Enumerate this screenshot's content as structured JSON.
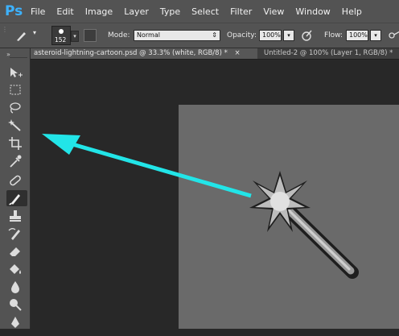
{
  "app": {
    "logo": "Ps"
  },
  "menu": [
    "File",
    "Edit",
    "Image",
    "Layer",
    "Type",
    "Select",
    "Filter",
    "View",
    "Window",
    "Help"
  ],
  "options": {
    "brush_size": "152",
    "mode_label": "Mode:",
    "mode_value": "Normal",
    "opacity_label": "Opacity:",
    "opacity_value": "100%",
    "flow_label": "Flow:",
    "flow_value": "100%"
  },
  "tabs": [
    {
      "label": "asteroid-lightning-cartoon.psd @ 33.3% (white, RGB/8) *",
      "close": "×",
      "active": true
    },
    {
      "label": "Untitled-2 @ 100% (Layer 1, RGB/8) *",
      "close": "×",
      "active": false
    }
  ],
  "annotation": {
    "arrow_color": "#22e5e8"
  },
  "icons": [
    "move-icon",
    "rect-marquee-icon",
    "lasso-icon",
    "magic-wand-icon",
    "crop-icon",
    "eyedropper-icon",
    "spot-healing-icon",
    "brush-icon",
    "clone-stamp-icon",
    "history-brush-icon",
    "eraser-icon",
    "paint-bucket-icon",
    "blur-icon",
    "dodge-icon",
    "pen-icon"
  ]
}
